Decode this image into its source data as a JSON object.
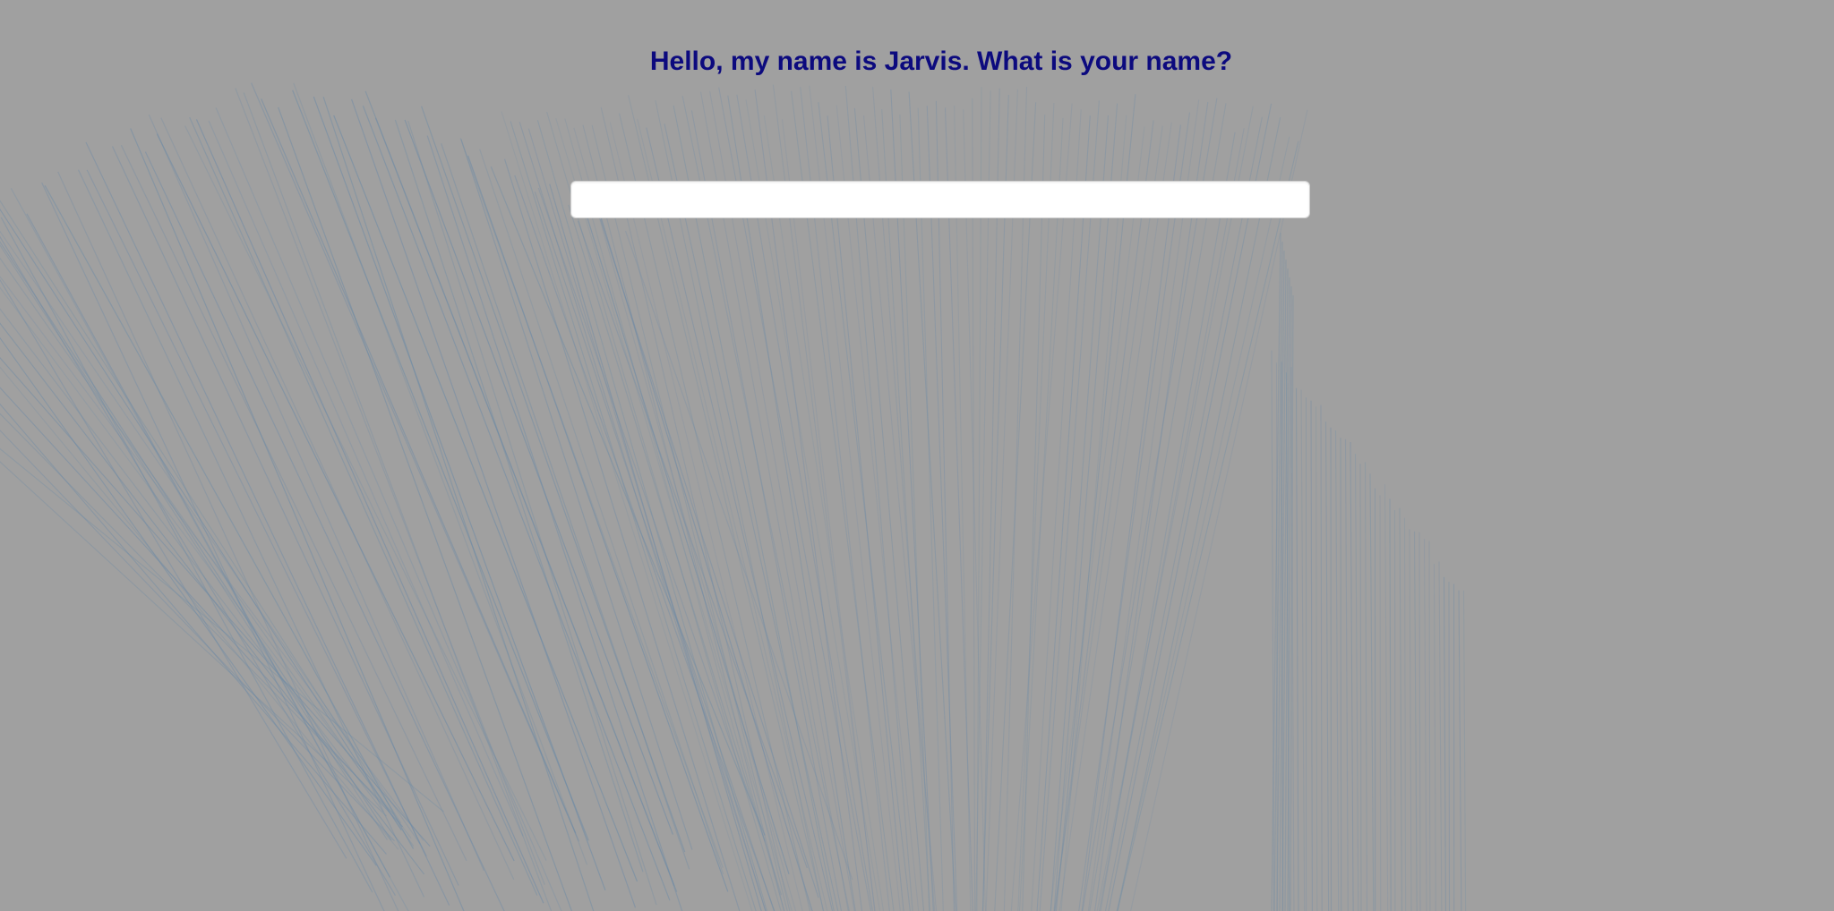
{
  "colors": {
    "background": "#a0a0a0",
    "heading": "#0c0a7e",
    "input_background": "#ffffff",
    "line_stroke": "#6c8aa6"
  },
  "prompt": {
    "text": "Hello, my name is Jarvis. What is your name?"
  },
  "name_input": {
    "value": "",
    "placeholder": ""
  }
}
